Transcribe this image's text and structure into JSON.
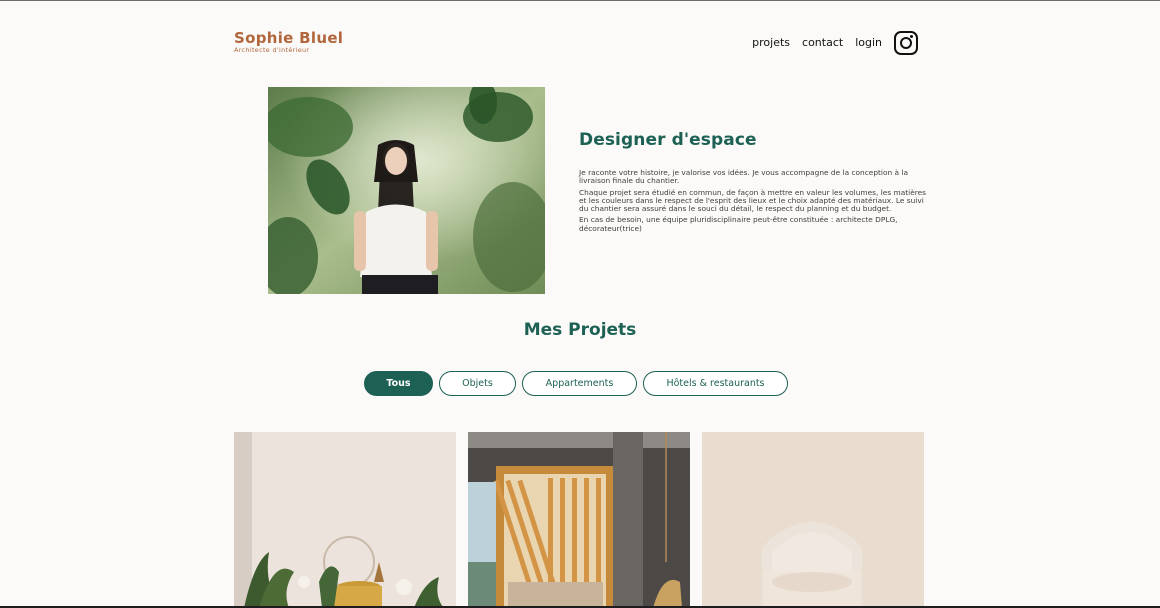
{
  "brand": {
    "title": "Sophie Bluel",
    "subtitle": "Architecte d'intérieur"
  },
  "nav": {
    "items": [
      "projets",
      "contact",
      "login"
    ],
    "social_icon": "instagram-icon"
  },
  "intro": {
    "title": "Designer d'espace",
    "paragraphs": [
      "Je raconte votre histoire, je valorise vos idées. Je vous accompagne de la conception à la livraison finale du chantier.",
      "Chaque projet sera étudié en commun, de façon à mettre en valeur les volumes, les matières et les couleurs dans le respect de l'esprit des lieux et le choix adapté des matériaux. Le suivi du chantier sera assuré dans le souci du détail, le respect du planning et du budget.",
      "En cas de besoin, une équipe pluridisciplinaire peut-être constituée : architecte DPLG, décorateur(trice)"
    ]
  },
  "projects": {
    "title": "Mes Projets",
    "filters": [
      {
        "label": "Tous",
        "active": true
      },
      {
        "label": "Objets",
        "active": false
      },
      {
        "label": "Appartements",
        "active": false
      },
      {
        "label": "Hôtels & restaurants",
        "active": false
      }
    ]
  },
  "colors": {
    "brand": "#b1663c",
    "accent": "#1d6154",
    "background": "#fbfaf9"
  }
}
